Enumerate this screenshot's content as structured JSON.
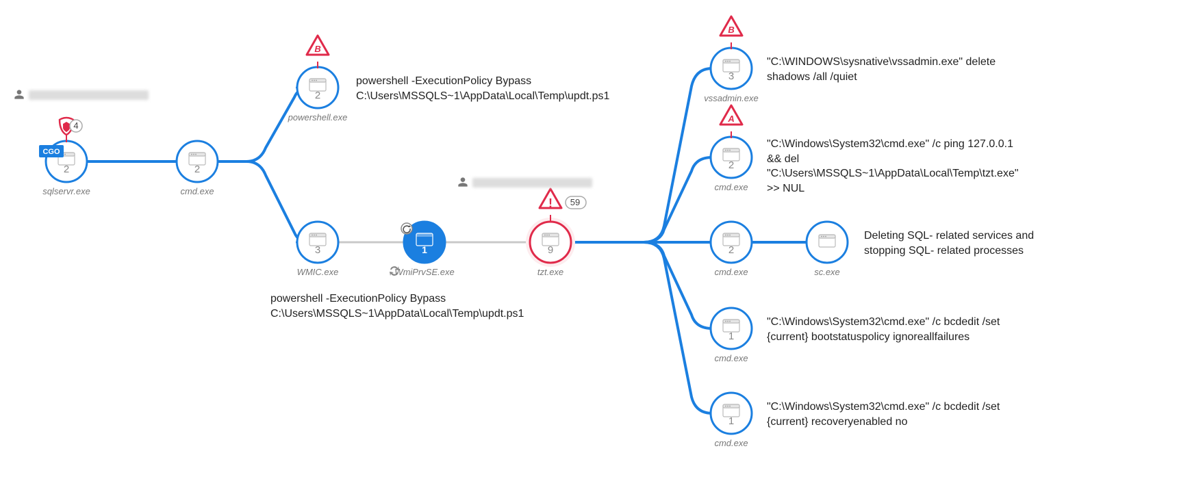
{
  "nodes": {
    "sqlservr": {
      "label": "sqlservr.exe",
      "count": "2",
      "tag": "CGO",
      "shield_count": "4"
    },
    "cmd_root": {
      "label": "cmd.exe",
      "count": "2"
    },
    "powershell": {
      "label": "powershell.exe",
      "count": "2",
      "tri": "B"
    },
    "wmic": {
      "label": "WMIC.exe",
      "count": "3"
    },
    "wmiprv": {
      "label": "WmiPrvSE.exe",
      "count": "1"
    },
    "tzt": {
      "label": "tzt.exe",
      "count": "9",
      "warn_count": "59"
    },
    "vssadmin": {
      "label": "vssadmin.exe",
      "count": "3",
      "tri": "B"
    },
    "cmd_ping": {
      "label": "cmd.exe",
      "count": "2",
      "tri": "A"
    },
    "cmd_sc": {
      "label": "cmd.exe",
      "count": "2"
    },
    "sc": {
      "label": "sc.exe",
      "count": ""
    },
    "cmd_bcd1": {
      "label": "cmd.exe",
      "count": "1"
    },
    "cmd_bcd2": {
      "label": "cmd.exe",
      "count": "1"
    }
  },
  "descriptions": {
    "ps_top": "powershell  -ExecutionPolicy Bypass C:\\Users\\MSSQLS~1\\AppData\\Local\\Temp\\updt.ps1",
    "ps_bot": "powershell  -ExecutionPolicy Bypass C:\\Users\\MSSQLS~1\\AppData\\Local\\Temp\\updt.ps1",
    "vss": "\"C:\\WINDOWS\\sysnative\\vssadmin.exe\" delete shadows /all /quiet",
    "ping": "\"C:\\Windows\\System32\\cmd.exe\" /c ping 127.0.0.1 && del \"C:\\Users\\MSSQLS~1\\AppData\\Local\\Temp\\tzt.exe\" >> NUL",
    "sc": "Deleting SQL- related services and stopping SQL- related processes",
    "bcd1": "\"C:\\Windows\\System32\\cmd.exe\" /c bcdedit /set {current} bootstatuspolicy ignoreallfailures",
    "bcd2": "\"C:\\Windows\\System32\\cmd.exe\" /c bcdedit /set {current} recoveryenabled no"
  }
}
